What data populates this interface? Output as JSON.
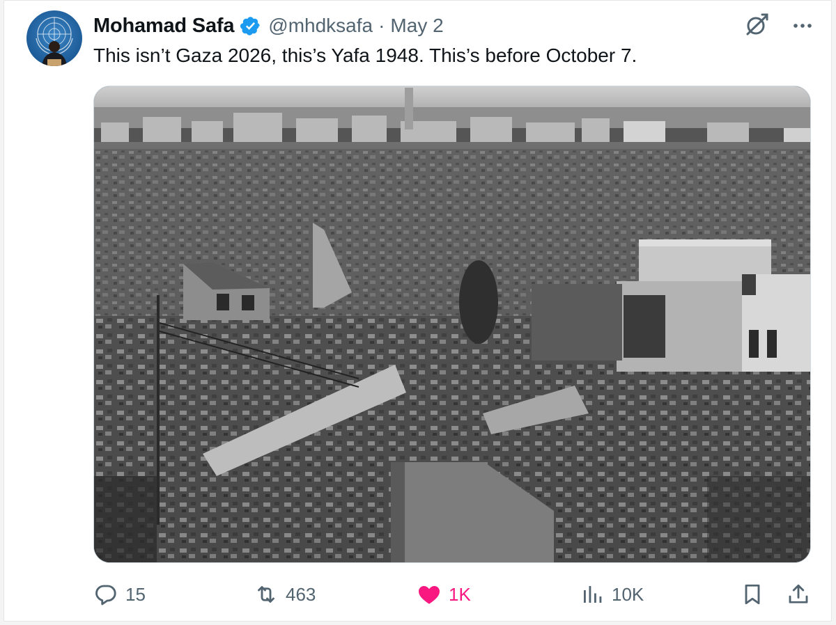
{
  "tweet": {
    "author_name": "Mohamad Safa",
    "handle": "@mhdksafa",
    "separator": "·",
    "date": "May 2",
    "text": "This isn’t Gaza 2026, this’s Yafa 1948. This’s before October 7.",
    "verified": true
  },
  "icons": {
    "verified": "verified-badge-icon",
    "grok": "grok-icon",
    "more": "more-icon",
    "reply": "reply-icon",
    "retweet": "retweet-icon",
    "like": "heart-icon",
    "views": "views-icon",
    "bookmark": "bookmark-icon",
    "share": "share-icon"
  },
  "metrics": {
    "replies": "15",
    "reposts": "463",
    "likes": "1K",
    "views": "10K"
  },
  "colors": {
    "verified_blue": "#1d9bf0",
    "like_pink": "#f91880",
    "muted_text": "#536471",
    "primary_text": "#0f1419"
  },
  "state": {
    "liked": true
  }
}
